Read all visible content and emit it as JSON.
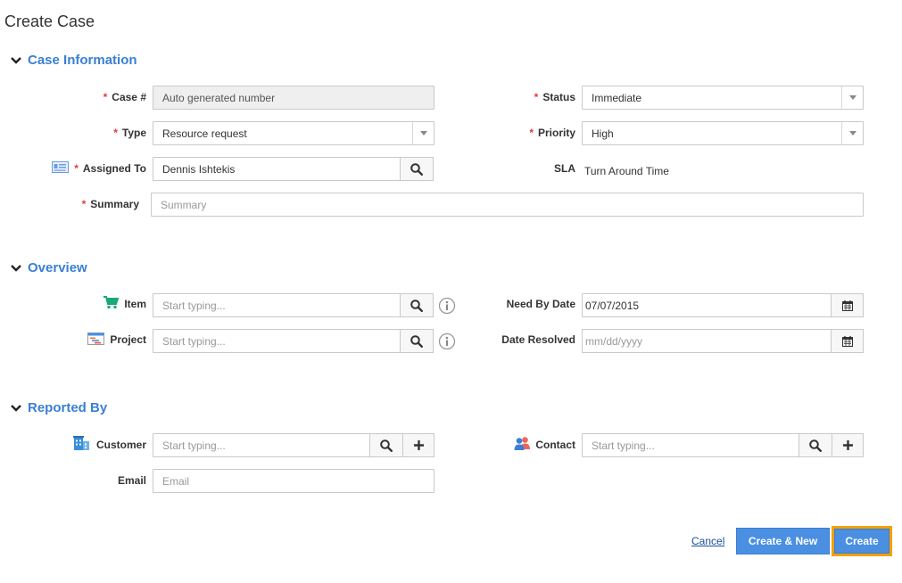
{
  "page": {
    "title": "Create Case"
  },
  "sections": {
    "case_information": "Case Information",
    "overview": "Overview",
    "reported_by": "Reported By"
  },
  "case_info": {
    "case_no": {
      "label": "Case #",
      "value": "Auto generated number"
    },
    "type": {
      "label": "Type",
      "value": "Resource request"
    },
    "assigned_to": {
      "label": "Assigned To",
      "value": "Dennis Ishtekis"
    },
    "summary": {
      "label": "Summary",
      "placeholder": "Summary"
    },
    "status": {
      "label": "Status",
      "value": "Immediate"
    },
    "priority": {
      "label": "Priority",
      "value": "High"
    },
    "sla": {
      "label": "SLA",
      "value": "Turn Around Time"
    }
  },
  "overview": {
    "item": {
      "label": "Item",
      "placeholder": "Start typing..."
    },
    "project": {
      "label": "Project",
      "placeholder": "Start typing..."
    },
    "need_by_date": {
      "label": "Need By Date",
      "value": "07/07/2015"
    },
    "date_resolved": {
      "label": "Date Resolved",
      "placeholder": "mm/dd/yyyy"
    }
  },
  "reported_by": {
    "customer": {
      "label": "Customer",
      "placeholder": "Start typing..."
    },
    "email": {
      "label": "Email",
      "placeholder": "Email"
    },
    "contact": {
      "label": "Contact",
      "placeholder": "Start typing..."
    }
  },
  "actions": {
    "cancel": "Cancel",
    "create_new": "Create & New",
    "create": "Create"
  },
  "colors": {
    "accent": "#3a7fd5",
    "required": "#e53935",
    "button": "#4a8fe2",
    "focus": "#f5a000"
  }
}
